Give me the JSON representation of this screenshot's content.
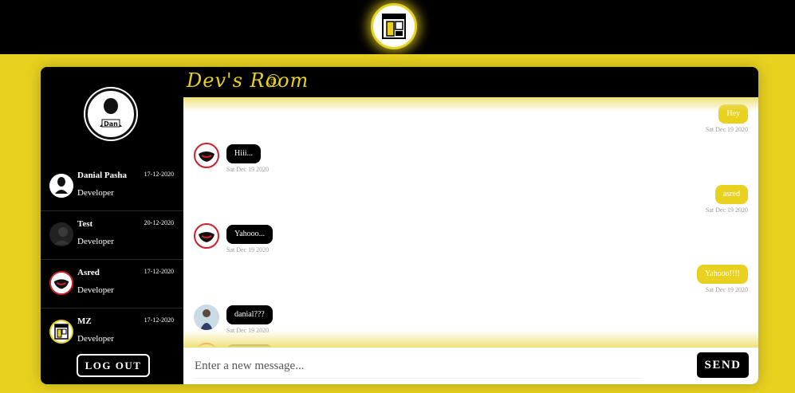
{
  "app": {
    "header_logo_icon": "devs-room-logo",
    "colors": {
      "accent": "#e8d21f",
      "dark": "#000000",
      "surface": "#ffffff",
      "muted": "#999999"
    }
  },
  "sidebar": {
    "profile_icon": "user-avatar",
    "contacts": [
      {
        "name": "Danial Pasha",
        "role": "Developer",
        "date": "17-12-2020",
        "icon": "avatar-danial"
      },
      {
        "name": "Test",
        "role": "Developer",
        "date": "20-12-2020",
        "icon": "avatar-test"
      },
      {
        "name": "Asred",
        "role": "Developer",
        "date": "17-12-2020",
        "icon": "avatar-asred"
      },
      {
        "name": "MZ",
        "role": "Developer",
        "date": "17-12-2020",
        "icon": "avatar-mz"
      }
    ],
    "logout_label": "LOG OUT"
  },
  "chat": {
    "title": "Dev's Room",
    "messages": [
      {
        "from": "me",
        "text": "Hey",
        "time": "Sat Dec 19 2020"
      },
      {
        "from": "other",
        "text": "Hiii...",
        "time": "Sat Dec 19 2020"
      },
      {
        "from": "me",
        "text": "asred",
        "time": "Sat Dec 19 2020"
      },
      {
        "from": "other",
        "text": "Yahooo...",
        "time": "Sat Dec 19 2020"
      },
      {
        "from": "me",
        "text": "Yahooo!!!!",
        "time": "Sat Dec 19 2020"
      },
      {
        "from": "other",
        "text": "danial???",
        "time": "Sat Dec 19 2020"
      }
    ]
  },
  "composer": {
    "placeholder": "Enter a new message...",
    "value": "",
    "send_label": "SEND"
  }
}
